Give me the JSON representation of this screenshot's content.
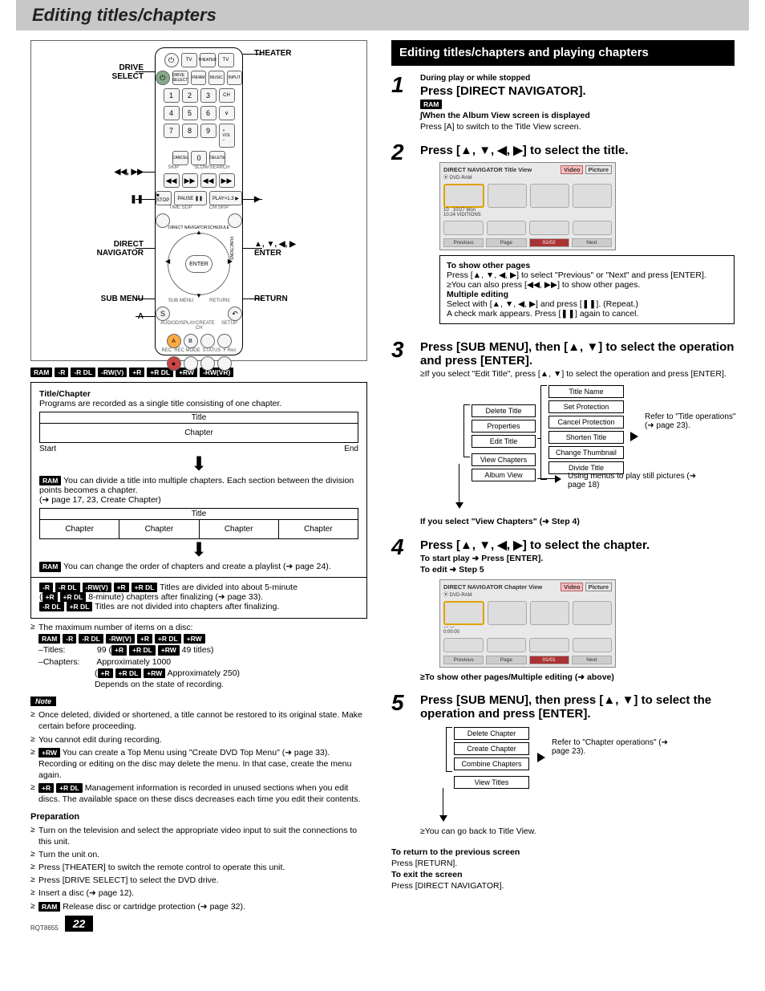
{
  "page_title": "Editing titles/chapters",
  "doc_code": "RQT8655",
  "page_number": "22",
  "remote_labels": {
    "drive_select": "DRIVE\nSELECT",
    "theater": "THEATER",
    "skip": "◀◀, ▶▶",
    "pause": "❚❚",
    "play": "▶",
    "direct_nav": "DIRECT\nNAVIGATOR",
    "arrows_enter": "▲, ▼, ◀, ▶\nENTER",
    "sub_menu": "SUB MENU",
    "return": "RETURN",
    "a": "A"
  },
  "remote_buttons": {
    "tv_power": "⏻",
    "tv": "TV",
    "theater": "THEATER",
    "tv2": "TV",
    "drive_select": "DRIVE SELECT",
    "fm": "FM/AM",
    "music": "MUSIC P.",
    "input": "INPUT AUX",
    "num": [
      "1",
      "2",
      "3",
      "4",
      "5",
      "6",
      "7",
      "8",
      "9",
      "0"
    ],
    "ch": "CH",
    "vol": "VOLUME",
    "cancel": "CANCEL",
    "delete": "DELETE",
    "skip_l": "◀◀",
    "skip_r": "▶▶",
    "stop": "■",
    "slow_l": "◀◀",
    "slow_r": "▶▶",
    "pause": "PAUSE ❚❚",
    "play": "PLAY ▶",
    "time_slip": "TIME SLIP",
    "cm_skip": "CM SKIP",
    "enter": "ENTER",
    "submenu": "S",
    "return": "RETURN",
    "schedule": "SCHEDULE",
    "a": "A",
    "b": "B",
    "audio": "AUDIO",
    "display": "DISPLAY",
    "create": "CREATE CHAPTER",
    "setup": "SETUP",
    "rec": "REC",
    "recmode": "REC MODE",
    "status": "STATUS",
    "frec": "F Rec"
  },
  "media_badges": [
    "RAM",
    "-R",
    "-R DL",
    "-RW(V)",
    "+R",
    "+R DL",
    "+RW",
    "-RW(VR)"
  ],
  "tc": {
    "heading": "Title/Chapter",
    "intro": "Programs are recorded as a single title consisting of one chapter.",
    "title": "Title",
    "chapter": "Chapter",
    "start": "Start",
    "end": "End",
    "divide_text_prefix": " You can divide a title into multiple chapters. Each section between the division points becomes a chapter.",
    "divide_ref": "(➔ page 17, 23, Create Chapter)",
    "reorder_text": " You can change the order of chapters and create a playlist (➜ page 24).",
    "finalize1_suffix": " Titles are divided into about 5-minute",
    "finalize1b": " 8-minute) chapters after finalizing (➜ page 33).",
    "finalize2_suffix": " Titles are not divided into chapters after finalizing."
  },
  "max_items": {
    "intro": "The maximum number of items on a disc:",
    "titles_label": "–Titles:",
    "titles_val": "99 (",
    "titles_val_suffix": " 49 titles)",
    "chapters_label": "–Chapters:",
    "chapters_val": "Approximately 1000",
    "chapters_val2_suffix": " Approximately 250)",
    "chapters_val3": "Depends on the state of recording."
  },
  "notes": [
    "Once deleted, divided or shortened, a title cannot be restored to its original state. Make certain before proceeding.",
    "You cannot edit during recording."
  ],
  "note_rw": " You can create a Top Menu using \"Create DVD Top Menu\" (➜ page 33). Recording or editing on the disc may delete the menu. In that case, create the menu again.",
  "note_mgmt": " Management information is recorded in unused sections when you edit discs. The available space on these discs decreases each time you edit their contents.",
  "prep": {
    "title": "Preparation",
    "items": [
      "Turn on the television and select the appropriate video input to suit the connections to this unit.",
      "Turn the unit on.",
      "Press [THEATER] to switch the remote control to operate this unit.",
      "Press [DRIVE SELECT] to select the DVD drive.",
      "Insert a disc (➜ page 12)."
    ],
    "ram_item": " Release disc or cartridge protection (➜ page 32)."
  },
  "right": {
    "section_title": "Editing titles/chapters and playing chapters",
    "step1": {
      "pre": "During play or while stopped",
      "main": "Press [DIRECT NAVIGATOR].",
      "album_line": "∫When the Album View screen is displayed",
      "album_sub": "Press [A] to switch to the Title View screen."
    },
    "step2": {
      "main": "Press [▲, ▼, ◀, ▶] to select the title.",
      "screen_title": "DIRECT NAVIGATOR Title View",
      "screen_media": "DVD-RAM",
      "screen_tabs": [
        "Video",
        "Picture"
      ],
      "screen_caption": "10   10/27 Mon\n10:24 VIDITIONS",
      "screen_prev": "Previous",
      "screen_page": "Page",
      "screen_pg": "02/02",
      "screen_next": "Next",
      "other_title": "To show other pages",
      "other_body": "Press [▲, ▼, ◀, ▶] to select \"Previous\" or \"Next\" and press [ENTER].",
      "other_body2": "You can also press [◀◀, ▶▶] to show other pages.",
      "multi_title": "Multiple editing",
      "multi_body": "Select with [▲, ▼, ◀, ▶] and press [❚❚]. (Repeat.)",
      "multi_body2": "A check mark appears. Press [❚❚] again to cancel."
    },
    "step3": {
      "main": "Press [SUB MENU], then [▲, ▼] to select the operation and press [ENTER].",
      "note": "If you select \"Edit Title\", press [▲, ▼] to select the operation and press [ENTER].",
      "menu_left": [
        "Delete Title",
        "Properties",
        "Edit Title",
        "View Chapters",
        "Album View"
      ],
      "menu_right": [
        "Title Name",
        "Set Protection",
        "Cancel Protection",
        "Shorten Title",
        "Change Thumbnail",
        "Divide Title"
      ],
      "ref1": "Refer to \"Title operations\" (➜ page 23).",
      "ref2": "Using menus to play still pictures (➜ page 18)",
      "sel_note": "If you select \"View Chapters\" (➜ Step 4)"
    },
    "step4": {
      "main": "Press [▲, ▼, ◀, ▶] to select the chapter.",
      "sub1": "To start play ➜ Press [ENTER].",
      "sub2": "To edit ➜ Step 5",
      "screen_title": "DIRECT NAVIGATOR Chapter View",
      "screen_media": "DVD-RAM",
      "screen_prev": "Previous",
      "screen_page": "Page",
      "screen_pg": "01/01",
      "screen_next": "Next",
      "after": "To show other pages/Multiple editing (➜ above)"
    },
    "step5": {
      "main": "Press [SUB MENU], then press [▲, ▼] to select the operation and press [ENTER].",
      "menu": [
        "Delete Chapter",
        "Create Chapter",
        "Combine Chapters",
        "View Titles"
      ],
      "ref": "Refer to \"Chapter operations\" (➜ page 23).",
      "back": "You can go back to Title View."
    },
    "footer": {
      "l1": "To return to the previous screen",
      "l2": "Press [RETURN].",
      "l3": "To exit the screen",
      "l4": "Press [DIRECT NAVIGATOR]."
    }
  }
}
